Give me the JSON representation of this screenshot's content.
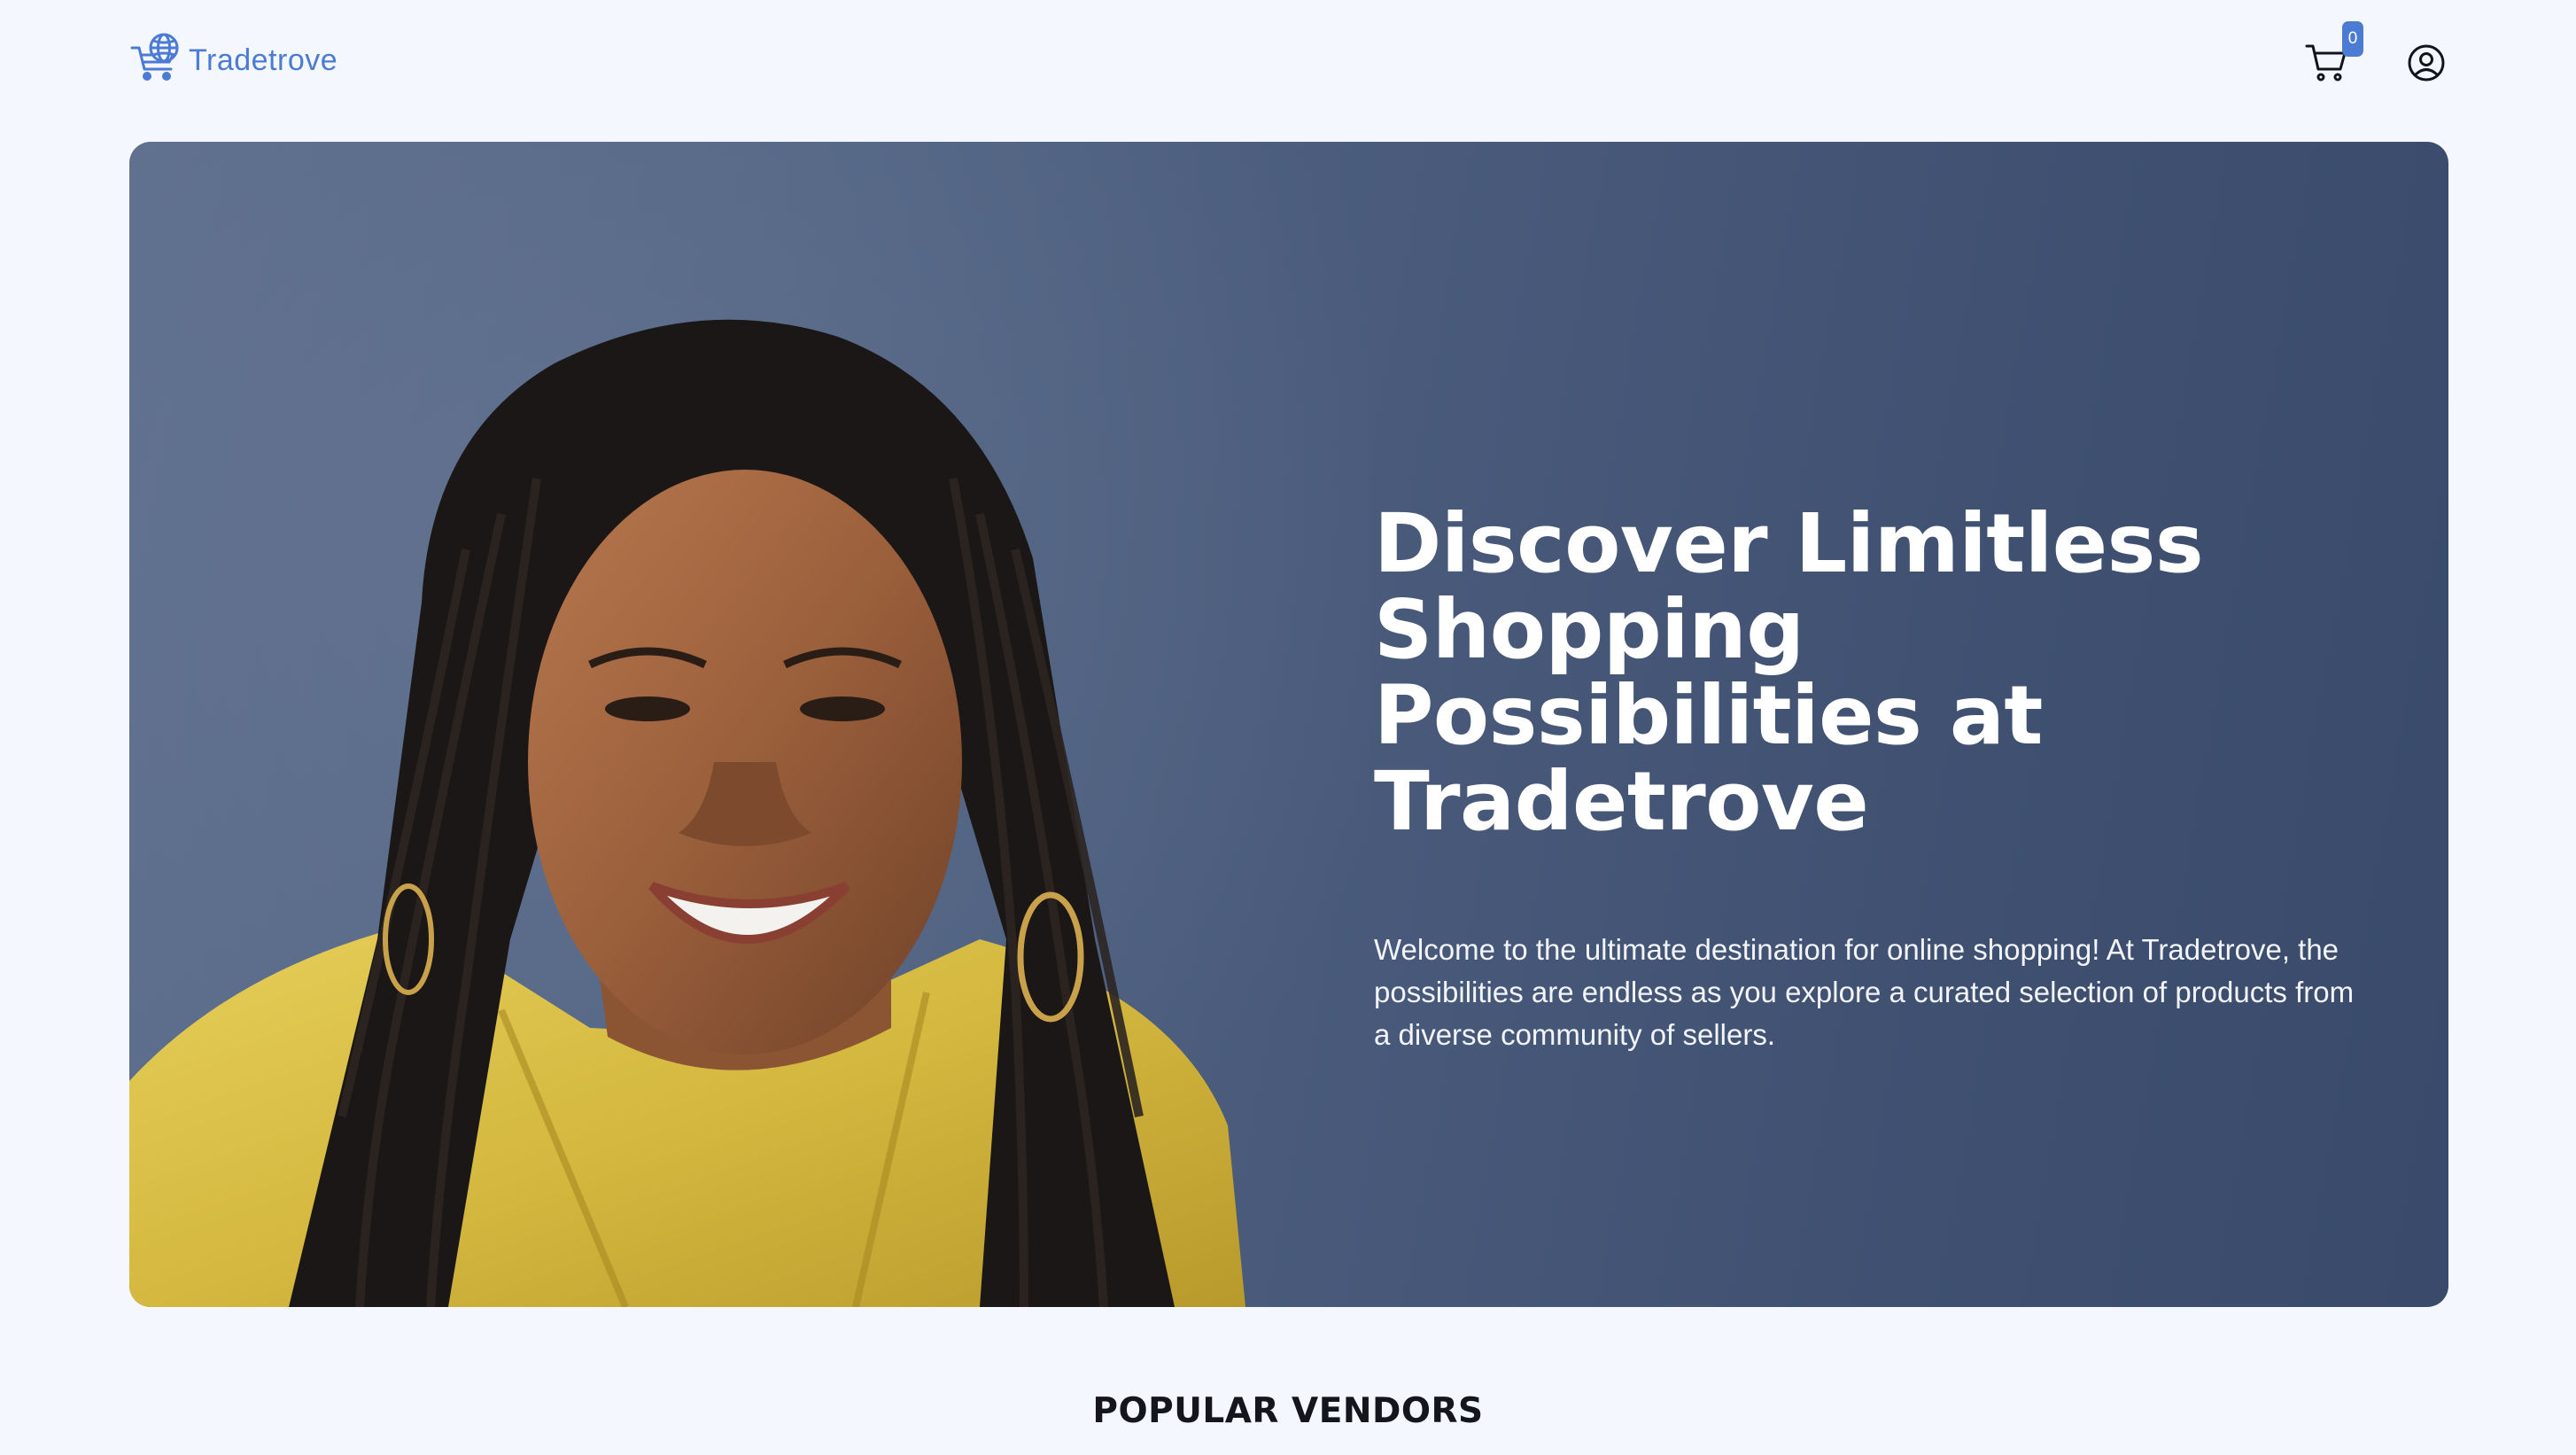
{
  "brand": {
    "name": "Tradetrove",
    "logo_icon": "shopping-cart-globe-icon",
    "accent_color": "#4b7bd3"
  },
  "header": {
    "cart_icon": "shopping-cart-icon",
    "cart_count": "0",
    "account_icon": "user-circle-icon"
  },
  "hero": {
    "title": "Discover Limitless Shopping Possibilities at Tradetrove",
    "subtitle": "Welcome to the ultimate destination for online shopping! At Tradetrove, the possibilities are endless as you explore a curated selection of products from a diverse community of sellers.",
    "background_color": "#48597a"
  },
  "sections": {
    "popular_vendors_title": "POPULAR VENDORS"
  }
}
